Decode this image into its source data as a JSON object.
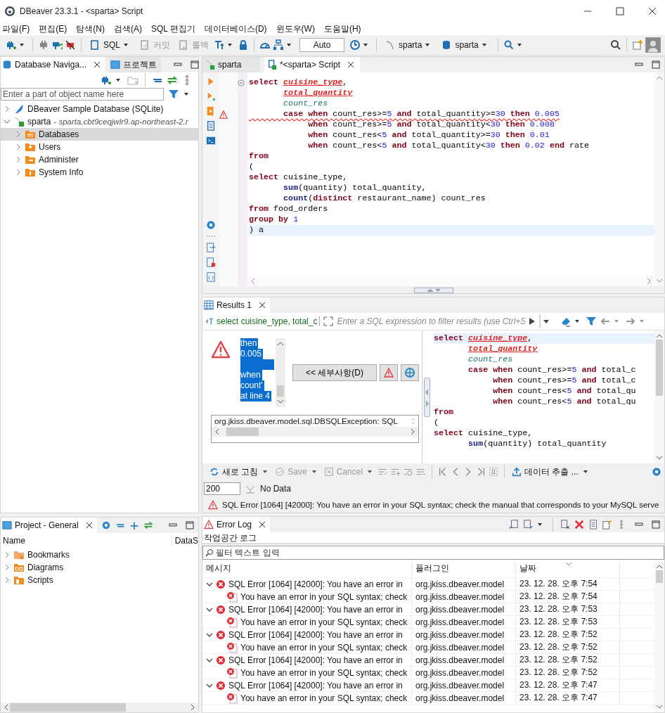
{
  "window": {
    "title": "DBeaver 23.3.1 - <sparta> Script"
  },
  "menu": [
    "파일(F)",
    "편집(E)",
    "탐색(N)",
    "검색(A)",
    "SQL 편집기",
    "데이터베이스(D)",
    "윈도우(W)",
    "도움말(H)"
  ],
  "toolbar": {
    "buttons": [
      {
        "kind": "sql",
        "label": "SQL",
        "disabled": false
      },
      {
        "kind": "commit",
        "label": "커밋",
        "disabled": true
      },
      {
        "kind": "rollback",
        "label": "롤백",
        "disabled": true
      }
    ],
    "transaction_mode": "Auto",
    "datasource": "sparta",
    "schema": "sparta"
  },
  "navigator": {
    "tabs": [
      {
        "label": "Database Naviga...",
        "selected": true
      },
      {
        "label": "프로젝트",
        "selected": false
      }
    ],
    "filter_placeholder": "Enter a part of object name here",
    "tree": [
      {
        "kind": "sqlite",
        "label": "DBeaver Sample Database (SQLite)",
        "expanded": false,
        "selected": false
      },
      {
        "kind": "connection",
        "label": "sparta",
        "detail": "- sparta.cbt9ceqjwlr9.ap-northeast-2.r",
        "expanded": true,
        "selected": false,
        "children": [
          {
            "kind": "databases",
            "label": "Databases",
            "expanded": false,
            "selected": true
          },
          {
            "kind": "users",
            "label": "Users",
            "expanded": false,
            "selected": false
          },
          {
            "kind": "administer",
            "label": "Administer",
            "expanded": false,
            "selected": false
          },
          {
            "kind": "info",
            "label": "System Info",
            "expanded": false,
            "selected": false
          }
        ]
      }
    ]
  },
  "editor": {
    "tabs": [
      {
        "label": "sparta",
        "selected": false
      },
      {
        "label": "*<sparta> Script",
        "selected": true
      }
    ],
    "lines": [
      {
        "warning": false,
        "current": false,
        "tokens": [
          {
            "kind": "kw",
            "text": "select "
          },
          {
            "kind": "err",
            "text": "cuisine_type"
          },
          {
            "kind": "id",
            "text": ","
          }
        ]
      },
      {
        "warning": false,
        "current": false,
        "tokens": [
          {
            "kind": "err",
            "text": "       total_quantity"
          }
        ]
      },
      {
        "warning": false,
        "current": false,
        "tokens": [
          {
            "kind": "col",
            "text": "       count_res"
          }
        ]
      },
      {
        "warning": true,
        "current": false,
        "tokens": [
          {
            "kind": "kw",
            "text": "       case when "
          },
          {
            "kind": "id",
            "text": "count_res>="
          },
          {
            "kind": "num",
            "text": "5"
          },
          {
            "kind": "kw",
            "text": " and "
          },
          {
            "kind": "id",
            "text": "total_quantity>="
          },
          {
            "kind": "num",
            "text": "30"
          },
          {
            "kind": "kw",
            "text": " then "
          },
          {
            "kind": "num",
            "text": "0.005"
          }
        ]
      },
      {
        "warning": false,
        "current": false,
        "tokens": [
          {
            "kind": "kw",
            "text": "            when "
          },
          {
            "kind": "id",
            "text": "count_res>="
          },
          {
            "kind": "num",
            "text": "5"
          },
          {
            "kind": "kw",
            "text": " and "
          },
          {
            "kind": "id",
            "text": "total_quantity<"
          },
          {
            "kind": "num",
            "text": "30"
          },
          {
            "kind": "kw",
            "text": " then "
          },
          {
            "kind": "num",
            "text": "0.008"
          }
        ]
      },
      {
        "warning": false,
        "current": false,
        "tokens": [
          {
            "kind": "kw",
            "text": "            when "
          },
          {
            "kind": "id",
            "text": "count_res<"
          },
          {
            "kind": "num",
            "text": "5"
          },
          {
            "kind": "kw",
            "text": " and "
          },
          {
            "kind": "id",
            "text": "total_quantity>="
          },
          {
            "kind": "num",
            "text": "30"
          },
          {
            "kind": "kw",
            "text": " then "
          },
          {
            "kind": "num",
            "text": "0.01"
          }
        ]
      },
      {
        "warning": false,
        "current": false,
        "tokens": [
          {
            "kind": "kw",
            "text": "            when "
          },
          {
            "kind": "id",
            "text": "count_res<"
          },
          {
            "kind": "num",
            "text": "5"
          },
          {
            "kind": "kw",
            "text": " and "
          },
          {
            "kind": "id",
            "text": "total_quantity<"
          },
          {
            "kind": "num",
            "text": "30"
          },
          {
            "kind": "kw",
            "text": " then "
          },
          {
            "kind": "num",
            "text": "0.02"
          },
          {
            "kind": "kw",
            "text": " end "
          },
          {
            "kind": "id",
            "text": "rate"
          }
        ]
      },
      {
        "warning": false,
        "current": false,
        "tokens": [
          {
            "kind": "kw",
            "text": "from"
          }
        ]
      },
      {
        "warning": false,
        "current": false,
        "tokens": [
          {
            "kind": "id",
            "text": "("
          }
        ]
      },
      {
        "warning": false,
        "current": false,
        "tokens": [
          {
            "kind": "kw",
            "text": "select "
          },
          {
            "kind": "id",
            "text": "cuisine_type,"
          }
        ]
      },
      {
        "warning": false,
        "current": false,
        "tokens": [
          {
            "kind": "fn",
            "text": "       sum"
          },
          {
            "kind": "id",
            "text": "(quantity) total_quantity,"
          }
        ]
      },
      {
        "warning": false,
        "current": false,
        "tokens": [
          {
            "kind": "fn",
            "text": "       count"
          },
          {
            "kind": "id",
            "text": "("
          },
          {
            "kind": "kw",
            "text": "distinct "
          },
          {
            "kind": "id",
            "text": "restaurant_name) count_res"
          }
        ]
      },
      {
        "warning": false,
        "current": false,
        "tokens": [
          {
            "kind": "kw",
            "text": "from "
          },
          {
            "kind": "id",
            "text": "food_orders"
          }
        ]
      },
      {
        "warning": false,
        "current": false,
        "tokens": [
          {
            "kind": "kw",
            "text": "group by "
          },
          {
            "kind": "num",
            "text": "1"
          }
        ]
      },
      {
        "warning": false,
        "current": true,
        "tokens": [
          {
            "kind": "id",
            "text": ") a"
          }
        ]
      }
    ]
  },
  "results": {
    "tab": "Results 1",
    "query": "select cuisine_type, total_c",
    "filter_placeholder": "Enter a SQL expression to filter results (use Ctrl+S",
    "error_excerpt": [
      {
        "text": "then",
        "blank_after": false
      },
      {
        "text": "0.005",
        "blank_after": true
      },
      {
        "text": "when",
        "blank_after": false
      },
      {
        "text": "count'",
        "blank_after": false
      },
      {
        "text": "at line 4",
        "blank_after": false
      }
    ],
    "details_button": "<< 세부사항(D)",
    "exception": "org.jkiss.dbeaver.model.sql.DBSQLException: SQL",
    "preview": [
      {
        "current": true,
        "tokens": [
          {
            "kind": "kw",
            "text": "select "
          },
          {
            "kind": "err",
            "text": "cuisine_type"
          },
          {
            "kind": "id",
            "text": ","
          }
        ]
      },
      {
        "current": false,
        "tokens": [
          {
            "kind": "err",
            "text": "       total_quantity"
          }
        ]
      },
      {
        "current": false,
        "tokens": [
          {
            "kind": "col",
            "text": "       count_res"
          }
        ]
      },
      {
        "current": false,
        "tokens": [
          {
            "kind": "kw",
            "text": "       case when "
          },
          {
            "kind": "id",
            "text": "count_res>="
          },
          {
            "kind": "num",
            "text": "5"
          },
          {
            "kind": "kw",
            "text": " and "
          },
          {
            "kind": "id",
            "text": "total_c"
          }
        ]
      },
      {
        "current": false,
        "tokens": [
          {
            "kind": "kw",
            "text": "            when "
          },
          {
            "kind": "id",
            "text": "count_res>="
          },
          {
            "kind": "num",
            "text": "5"
          },
          {
            "kind": "kw",
            "text": " and "
          },
          {
            "kind": "id",
            "text": "total_c"
          }
        ]
      },
      {
        "current": false,
        "tokens": [
          {
            "kind": "kw",
            "text": "            when "
          },
          {
            "kind": "id",
            "text": "count_res<"
          },
          {
            "kind": "num",
            "text": "5"
          },
          {
            "kind": "kw",
            "text": " and "
          },
          {
            "kind": "id",
            "text": "total_qu"
          }
        ]
      },
      {
        "current": false,
        "tokens": [
          {
            "kind": "kw",
            "text": "            when "
          },
          {
            "kind": "id",
            "text": "count_res<"
          },
          {
            "kind": "num",
            "text": "5"
          },
          {
            "kind": "kw",
            "text": " and "
          },
          {
            "kind": "id",
            "text": "total_qu"
          }
        ]
      },
      {
        "current": false,
        "tokens": [
          {
            "kind": "kw",
            "text": "from"
          }
        ]
      },
      {
        "current": false,
        "tokens": [
          {
            "kind": "id",
            "text": "("
          }
        ]
      },
      {
        "current": false,
        "tokens": [
          {
            "kind": "kw",
            "text": "select "
          },
          {
            "kind": "id",
            "text": "cuisine_type,"
          }
        ]
      },
      {
        "current": false,
        "tokens": [
          {
            "kind": "fn",
            "text": "       sum"
          },
          {
            "kind": "id",
            "text": "(quantity) total_quantity"
          }
        ]
      }
    ],
    "actions": [
      {
        "kind": "refresh",
        "label": "새로 고침",
        "disabled": false
      },
      {
        "kind": "save",
        "label": "Save",
        "disabled": true
      },
      {
        "kind": "cancel",
        "label": "Cancel",
        "disabled": true
      }
    ],
    "export_label": "데이터 추출 ...",
    "fetch_size": "200",
    "row_status": "No Data",
    "status": "SQL Error [1064] [42000]: You have an error in your SQL syntax; check the manual that corresponds to your MySQL serve"
  },
  "project": {
    "tab": "Project - General",
    "columns": [
      "Name",
      "DataS"
    ],
    "items": [
      {
        "kind": "bookmarks",
        "label": "Bookmarks",
        "expanded": false
      },
      {
        "kind": "diagrams",
        "label": "Diagrams",
        "expanded": false
      },
      {
        "kind": "scripts",
        "label": "Scripts",
        "expanded": false
      }
    ]
  },
  "error_log": {
    "tab": "Error Log",
    "heading": "작업공간 로그",
    "filter_placeholder": "필터 텍스트 입력",
    "columns": [
      "메시지",
      "플러그인",
      "날짜"
    ],
    "entries": [
      {
        "message": "SQL Error [1064] [42000]: You have an error in",
        "plugin": "org.jkiss.dbeaver.model",
        "date": "23. 12. 28. 오후 7:54",
        "expanded": true,
        "children": [
          {
            "message": "You have an error in your SQL syntax; check",
            "plugin": "org.jkiss.dbeaver.model",
            "date": "23. 12. 28. 오후 7:54"
          }
        ]
      },
      {
        "message": "SQL Error [1064] [42000]: You have an error in",
        "plugin": "org.jkiss.dbeaver.model",
        "date": "23. 12. 28. 오후 7:53",
        "expanded": true,
        "children": [
          {
            "message": "You have an error in your SQL syntax; check",
            "plugin": "org.jkiss.dbeaver.model",
            "date": "23. 12. 28. 오후 7:53"
          }
        ]
      },
      {
        "message": "SQL Error [1064] [42000]: You have an error in",
        "plugin": "org.jkiss.dbeaver.model",
        "date": "23. 12. 28. 오후 7:52",
        "expanded": true,
        "children": [
          {
            "message": "You have an error in your SQL syntax; check",
            "plugin": "org.jkiss.dbeaver.model",
            "date": "23. 12. 28. 오후 7:52"
          }
        ]
      },
      {
        "message": "SQL Error [1064] [42000]: You have an error in",
        "plugin": "org.jkiss.dbeaver.model",
        "date": "23. 12. 28. 오후 7:52",
        "expanded": true,
        "children": [
          {
            "message": "You have an error in your SQL syntax; check",
            "plugin": "org.jkiss.dbeaver.model",
            "date": "23. 12. 28. 오후 7:52"
          }
        ]
      },
      {
        "message": "SQL Error [1064] [42000]: You have an error in",
        "plugin": "org.jkiss.dbeaver.model",
        "date": "23. 12. 28. 오후 7:47",
        "expanded": true,
        "children": [
          {
            "message": "You have an error in your SQL syntax; check",
            "plugin": "org.jkiss.dbeaver.model",
            "date": "23. 12. 28. 오후 7:47"
          }
        ]
      }
    ]
  }
}
